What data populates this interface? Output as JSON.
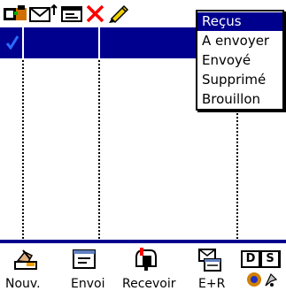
{
  "colors": {
    "accent_blue": "#00008e",
    "red_x": "#ff0000",
    "check_blue": "#2a6cff"
  },
  "top_toolbar": {
    "icons": [
      "folder-icon",
      "send-mail-icon",
      "message-icon",
      "delete-icon",
      "pencil-icon"
    ]
  },
  "folders": {
    "selected": "Reçus",
    "items": [
      "Reçus",
      "A envoyer",
      "Envoyé",
      "Supprimé",
      "Brouillon"
    ]
  },
  "bottom_toolbar": {
    "buttons": [
      {
        "label": "Nouv.",
        "icon": "compose-hand-icon"
      },
      {
        "label": "Envoi",
        "icon": "outbox-envelope-icon"
      },
      {
        "label": "Recevoir",
        "icon": "mailbox-icon"
      },
      {
        "label": "E+R",
        "icon": "send-receive-icon"
      }
    ],
    "ds_letters": [
      "D",
      "S"
    ],
    "hotsync_icon": "hotsync-icon"
  }
}
